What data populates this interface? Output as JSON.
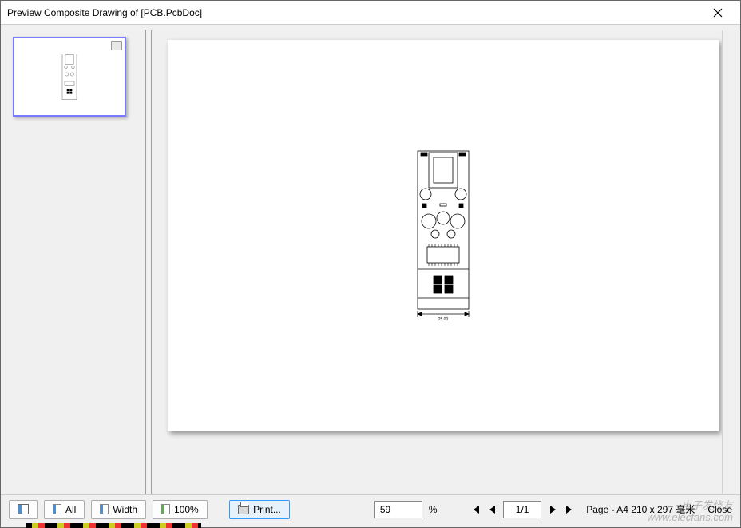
{
  "window": {
    "title": "Preview Composite Drawing of [PCB.PcbDoc]"
  },
  "toolbar": {
    "all_label": "All",
    "width_label": "Width",
    "hundred_label": "100%",
    "print_label": "Print...",
    "zoom_value": "59",
    "zoom_suffix": "%",
    "page_value": "1/1",
    "page_info": "Page - A4 210 x 297 毫米",
    "close_label": "Close"
  },
  "pcb": {
    "dimension_label": "25.00"
  },
  "watermark": {
    "line1": "电子发烧友",
    "line2": "www.elecfans.com"
  }
}
